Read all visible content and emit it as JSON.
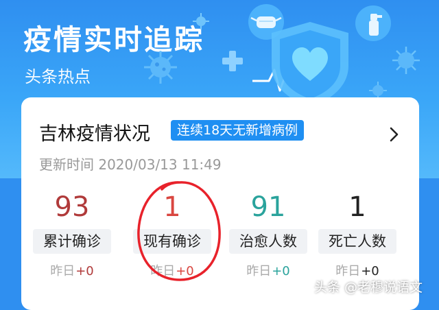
{
  "header": {
    "title": "疫情实时追踪",
    "subtitle": "头条热点"
  },
  "card": {
    "title": "吉林疫情状况",
    "badge": "连续18天无新增病例",
    "updated": "更新时间 2020/03/13 11:49",
    "stats": [
      {
        "value": "93",
        "label": "累计确诊",
        "yday_prefix": "昨日",
        "yday_delta": "+0",
        "color": "#b03a3a",
        "delta_color": "#b03a3a"
      },
      {
        "value": "1",
        "label": "现有确诊",
        "yday_prefix": "昨日",
        "yday_delta": "+0",
        "color": "#d94640",
        "delta_color": "#d94640"
      },
      {
        "value": "91",
        "label": "治愈人数",
        "yday_prefix": "昨日",
        "yday_delta": "+0",
        "color": "#2aa39c",
        "delta_color": "#2aa39c"
      },
      {
        "value": "1",
        "label": "死亡人数",
        "yday_prefix": "昨日",
        "yday_delta": "+0",
        "color": "#222222",
        "delta_color": "#222222"
      }
    ]
  },
  "watermark": "头条 @老穆说语文",
  "icons": {
    "virus": "virus-icon",
    "mask": "mask-icon",
    "spray": "spray-bottle-icon",
    "cross": "medical-cross-icon",
    "shield": "shield-heart-icon",
    "chevron": "chevron-right-icon"
  },
  "colors": {
    "brand_blue": "#2f8ff0",
    "badge_blue": "#1f8ff2",
    "annotation_red": "#e8222b"
  }
}
